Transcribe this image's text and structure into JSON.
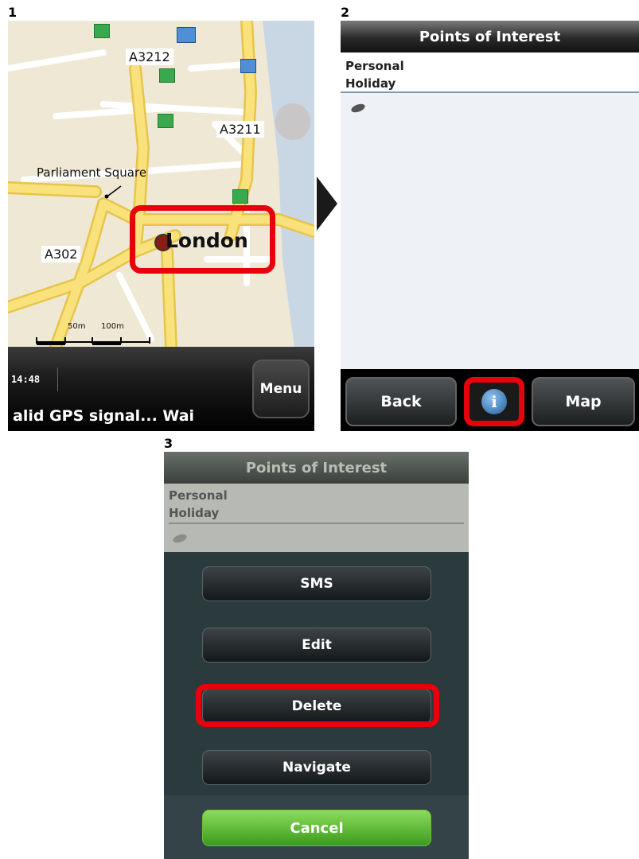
{
  "steps": [
    "1",
    "2",
    "3"
  ],
  "map_screen": {
    "road_labels": [
      "A3212",
      "A3211",
      "A302"
    ],
    "place_label": "Parliament Square",
    "city_label": "London",
    "scale_labels": [
      "50m",
      "100m"
    ],
    "clock": "14:48",
    "status": "alid GPS signal...   Wai",
    "menu_label": "Menu",
    "colors": {
      "highlight": "#e8000b",
      "major_road": "#f6d65a",
      "water": "#c9d6e3",
      "map_bg": "#efe8d5"
    },
    "icons": [
      "hotel-icon",
      "tube-station-icon",
      "fuel-station-icon",
      "map-pin-icon"
    ]
  },
  "poi_screen": {
    "title": "Points of Interest",
    "breadcrumb": [
      "Personal",
      "Holiday"
    ],
    "back_label": "Back",
    "map_label": "Map",
    "info_icon": "i"
  },
  "options_screen": {
    "title": "Points of Interest",
    "breadcrumb": [
      "Personal",
      "Holiday"
    ],
    "buttons": [
      "SMS",
      "Edit",
      "Delete",
      "Navigate"
    ],
    "cancel_label": "Cancel",
    "colors": {
      "cancel": "#4fae2b"
    }
  }
}
